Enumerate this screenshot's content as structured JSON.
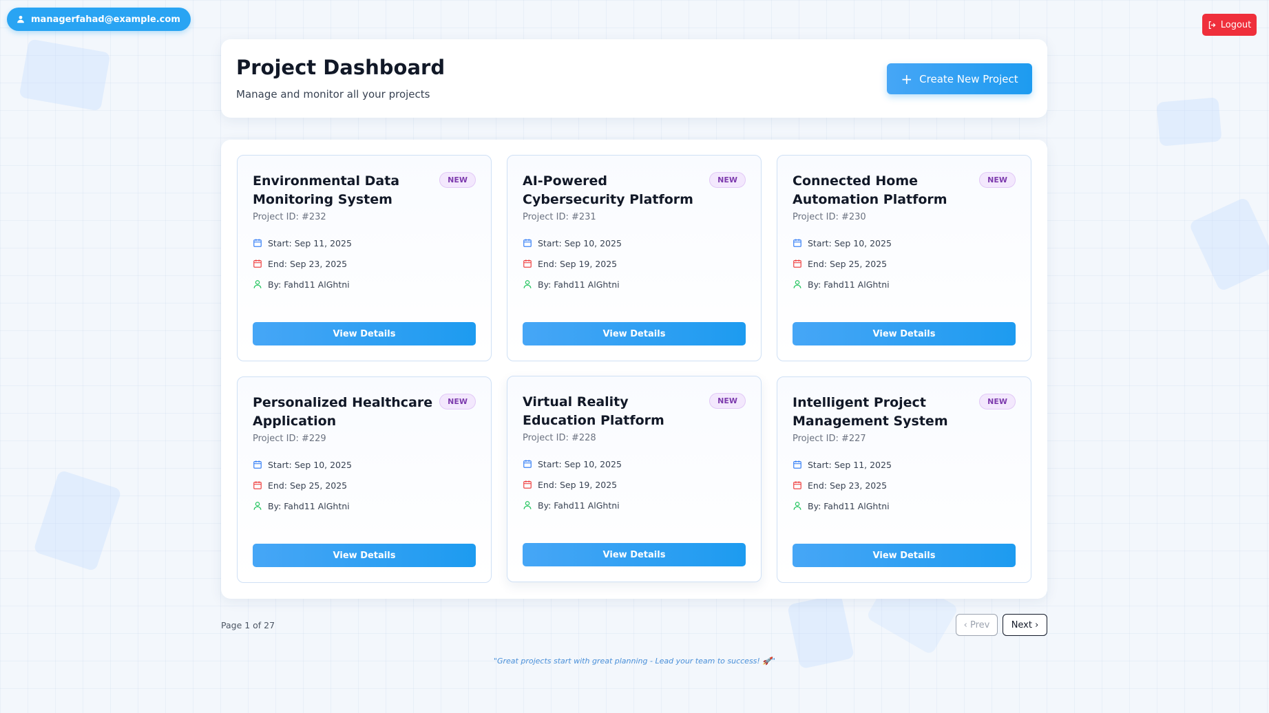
{
  "user": {
    "email": "managerfahad@example.com"
  },
  "logout_label": "Logout",
  "header": {
    "title": "Project Dashboard",
    "subtitle": "Manage and monitor all your projects",
    "create_label": "Create New Project"
  },
  "projects": [
    {
      "title": "Environmental Data Monitoring System",
      "badge": "NEW",
      "id": "Project ID: #232",
      "start": "Start: Sep 11, 2025",
      "end": "End: Sep 23, 2025",
      "by": "By: Fahd11 AlGhtni",
      "button": "View Details"
    },
    {
      "title": "AI-Powered Cybersecurity Platform",
      "badge": "NEW",
      "id": "Project ID: #231",
      "start": "Start: Sep 10, 2025",
      "end": "End: Sep 19, 2025",
      "by": "By: Fahd11 AlGhtni",
      "button": "View Details"
    },
    {
      "title": "Connected Home Automation Platform",
      "badge": "NEW",
      "id": "Project ID: #230",
      "start": "Start: Sep 10, 2025",
      "end": "End: Sep 25, 2025",
      "by": "By: Fahd11 AlGhtni",
      "button": "View Details"
    },
    {
      "title": "Personalized Healthcare Application",
      "badge": "NEW",
      "id": "Project ID: #229",
      "start": "Start: Sep 10, 2025",
      "end": "End: Sep 25, 2025",
      "by": "By: Fahd11 AlGhtni",
      "button": "View Details"
    },
    {
      "title": "Virtual Reality Education Platform",
      "badge": "NEW",
      "id": "Project ID: #228",
      "start": "Start: Sep 10, 2025",
      "end": "End: Sep 19, 2025",
      "by": "By: Fahd11 AlGhtni",
      "button": "View Details"
    },
    {
      "title": "Intelligent Project Management System",
      "badge": "NEW",
      "id": "Project ID: #227",
      "start": "Start: Sep 11, 2025",
      "end": "End: Sep 23, 2025",
      "by": "By: Fahd11 AlGhtni",
      "button": "View Details"
    }
  ],
  "pagination": {
    "info": "Page 1 of 27",
    "prev": "‹ Prev",
    "next": "Next ›"
  },
  "quote": "\"Great projects start with great planning - Lead your team to success! 🚀\"",
  "colors": {
    "accent": "#1d9bf0",
    "logout": "#ef2f3b",
    "badge_bg": "#f3e8fd",
    "badge_text": "#7c3aad",
    "start_icon": "#3b82f6",
    "end_icon": "#ef4444",
    "user_icon": "#22c55e"
  },
  "icons": {
    "user_pill": "user-icon",
    "logout": "logout-icon",
    "create": "plus-icon",
    "start": "calendar-icon",
    "end": "calendar-icon",
    "by": "user-icon"
  }
}
